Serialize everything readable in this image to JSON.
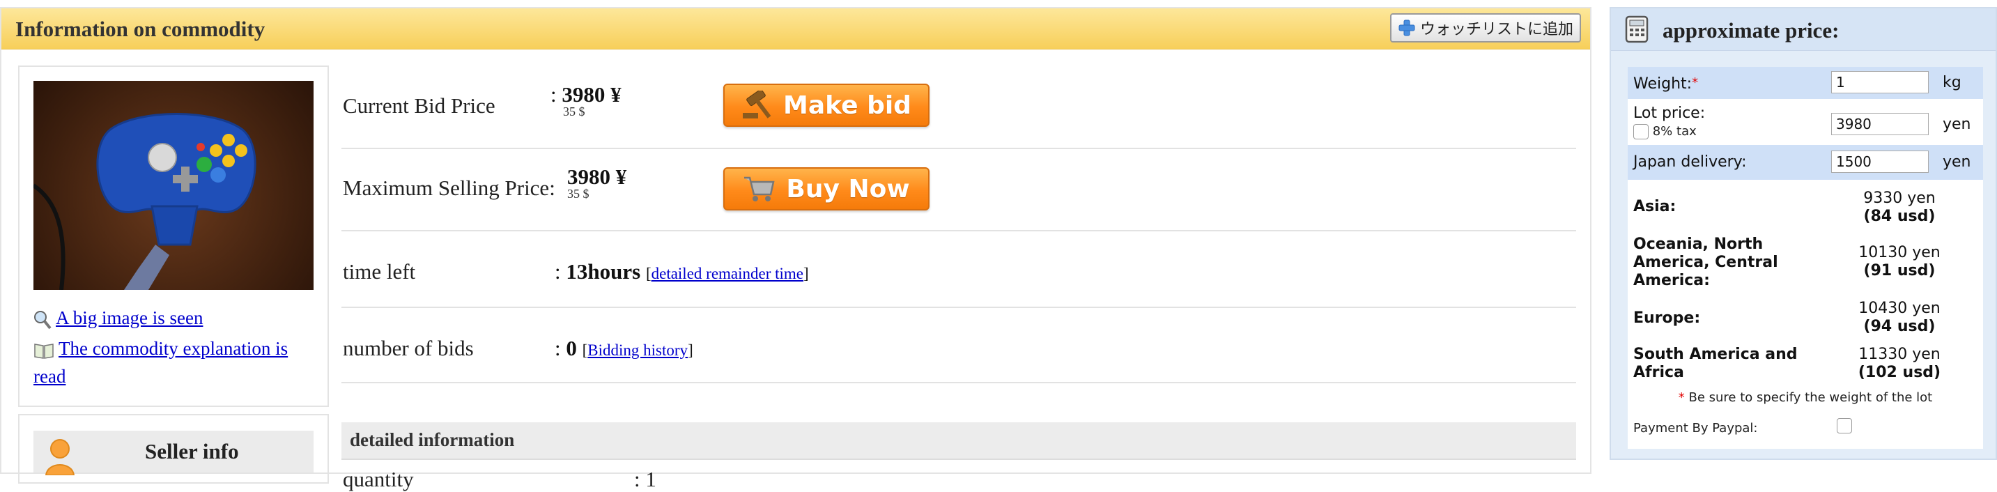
{
  "commodity": {
    "title": "Information on commodity",
    "watchlist_label": "ウォッチリストに追加",
    "image_links": {
      "big_image": "A big image is seen",
      "explanation": "The commodity explanation is read"
    },
    "seller_title": "Seller info",
    "rows": {
      "current_bid": {
        "label": "Current Bid Price",
        "colon": ":",
        "yen": "3980 ¥",
        "usd": "35 $",
        "button": "Make bid"
      },
      "max_price": {
        "label": "Maximum Selling Price:",
        "yen": "3980 ¥",
        "usd": "35 $",
        "button": "Buy Now"
      },
      "time_left": {
        "label": "time left",
        "colon": ":",
        "value": "13hours",
        "link": "detailed remainder time"
      },
      "bids": {
        "label": "number of bids",
        "colon": ":",
        "value": "0",
        "link": "Bidding history"
      }
    },
    "detail_title": "detailed information",
    "quantity_label": "quantity",
    "quantity_value": ": 1"
  },
  "price_calc": {
    "title": "approximate price:",
    "weight_label": "Weight:",
    "required_mark": "*",
    "weight_value": "1",
    "weight_unit": "kg",
    "lot_label": "Lot price:",
    "tax_label": "8% tax",
    "lot_value": "3980",
    "lot_unit": "yen",
    "delivery_label": "Japan delivery:",
    "delivery_value": "1500",
    "delivery_unit": "yen",
    "regions": [
      {
        "name": "Asia:",
        "yen": "9330 yen",
        "usd": "(84 usd)"
      },
      {
        "name": "Oceania, North America, Central America:",
        "yen": "10130 yen",
        "usd": "(91 usd)"
      },
      {
        "name": "Europe:",
        "yen": "10430 yen",
        "usd": "(94 usd)"
      },
      {
        "name": "South America and Africa",
        "yen": "11330 yen",
        "usd": "(102 usd)"
      }
    ],
    "note": "Be sure to specify the weight of the lot",
    "paypal_label": "Payment By Paypal:"
  },
  "colors": {
    "header_yellow": "#f7cf5a",
    "button_orange": "#ff8a1a",
    "link_blue": "#0000cc",
    "panel_blue": "#e3edf8"
  }
}
